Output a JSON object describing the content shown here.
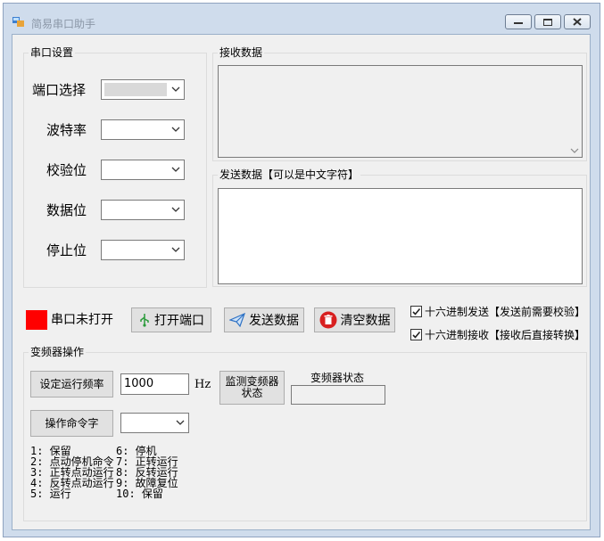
{
  "window": {
    "title": "简易串口助手"
  },
  "serial_settings": {
    "group_label": "串口设置",
    "port_label": "端口选择",
    "baud_label": "波特率",
    "parity_label": "校验位",
    "databits_label": "数据位",
    "stopbits_label": "停止位"
  },
  "receive": {
    "group_label": "接收数据"
  },
  "send": {
    "group_label": "发送数据【可以是中文字符】"
  },
  "controls": {
    "status_text": "串口未打开",
    "status_color": "#ff0000",
    "open_port": "打开端口",
    "send_data": "发送数据",
    "clear_data": "清空数据",
    "hex_send": "十六进制发送【发送前需要校验】",
    "hex_receive": "十六进制接收【接收后直接转换】"
  },
  "inverter": {
    "group_label": "变频器操作",
    "set_freq_button": "设定运行频率",
    "freq_value": "1000",
    "freq_unit": "Hz",
    "monitor_button_line1": "监测变频器",
    "monitor_button_line2": "状态",
    "status_label": "变频器状态",
    "command_button": "操作命令字",
    "legend_left": [
      "1: 保留",
      "2: 点动停机命令",
      "3: 正转点动运行",
      "4: 反转点动运行",
      "5: 运行"
    ],
    "legend_right": [
      "6: 停机",
      "7: 正转运行",
      "8: 反转运行",
      "9: 故障复位",
      "10: 保留"
    ]
  }
}
